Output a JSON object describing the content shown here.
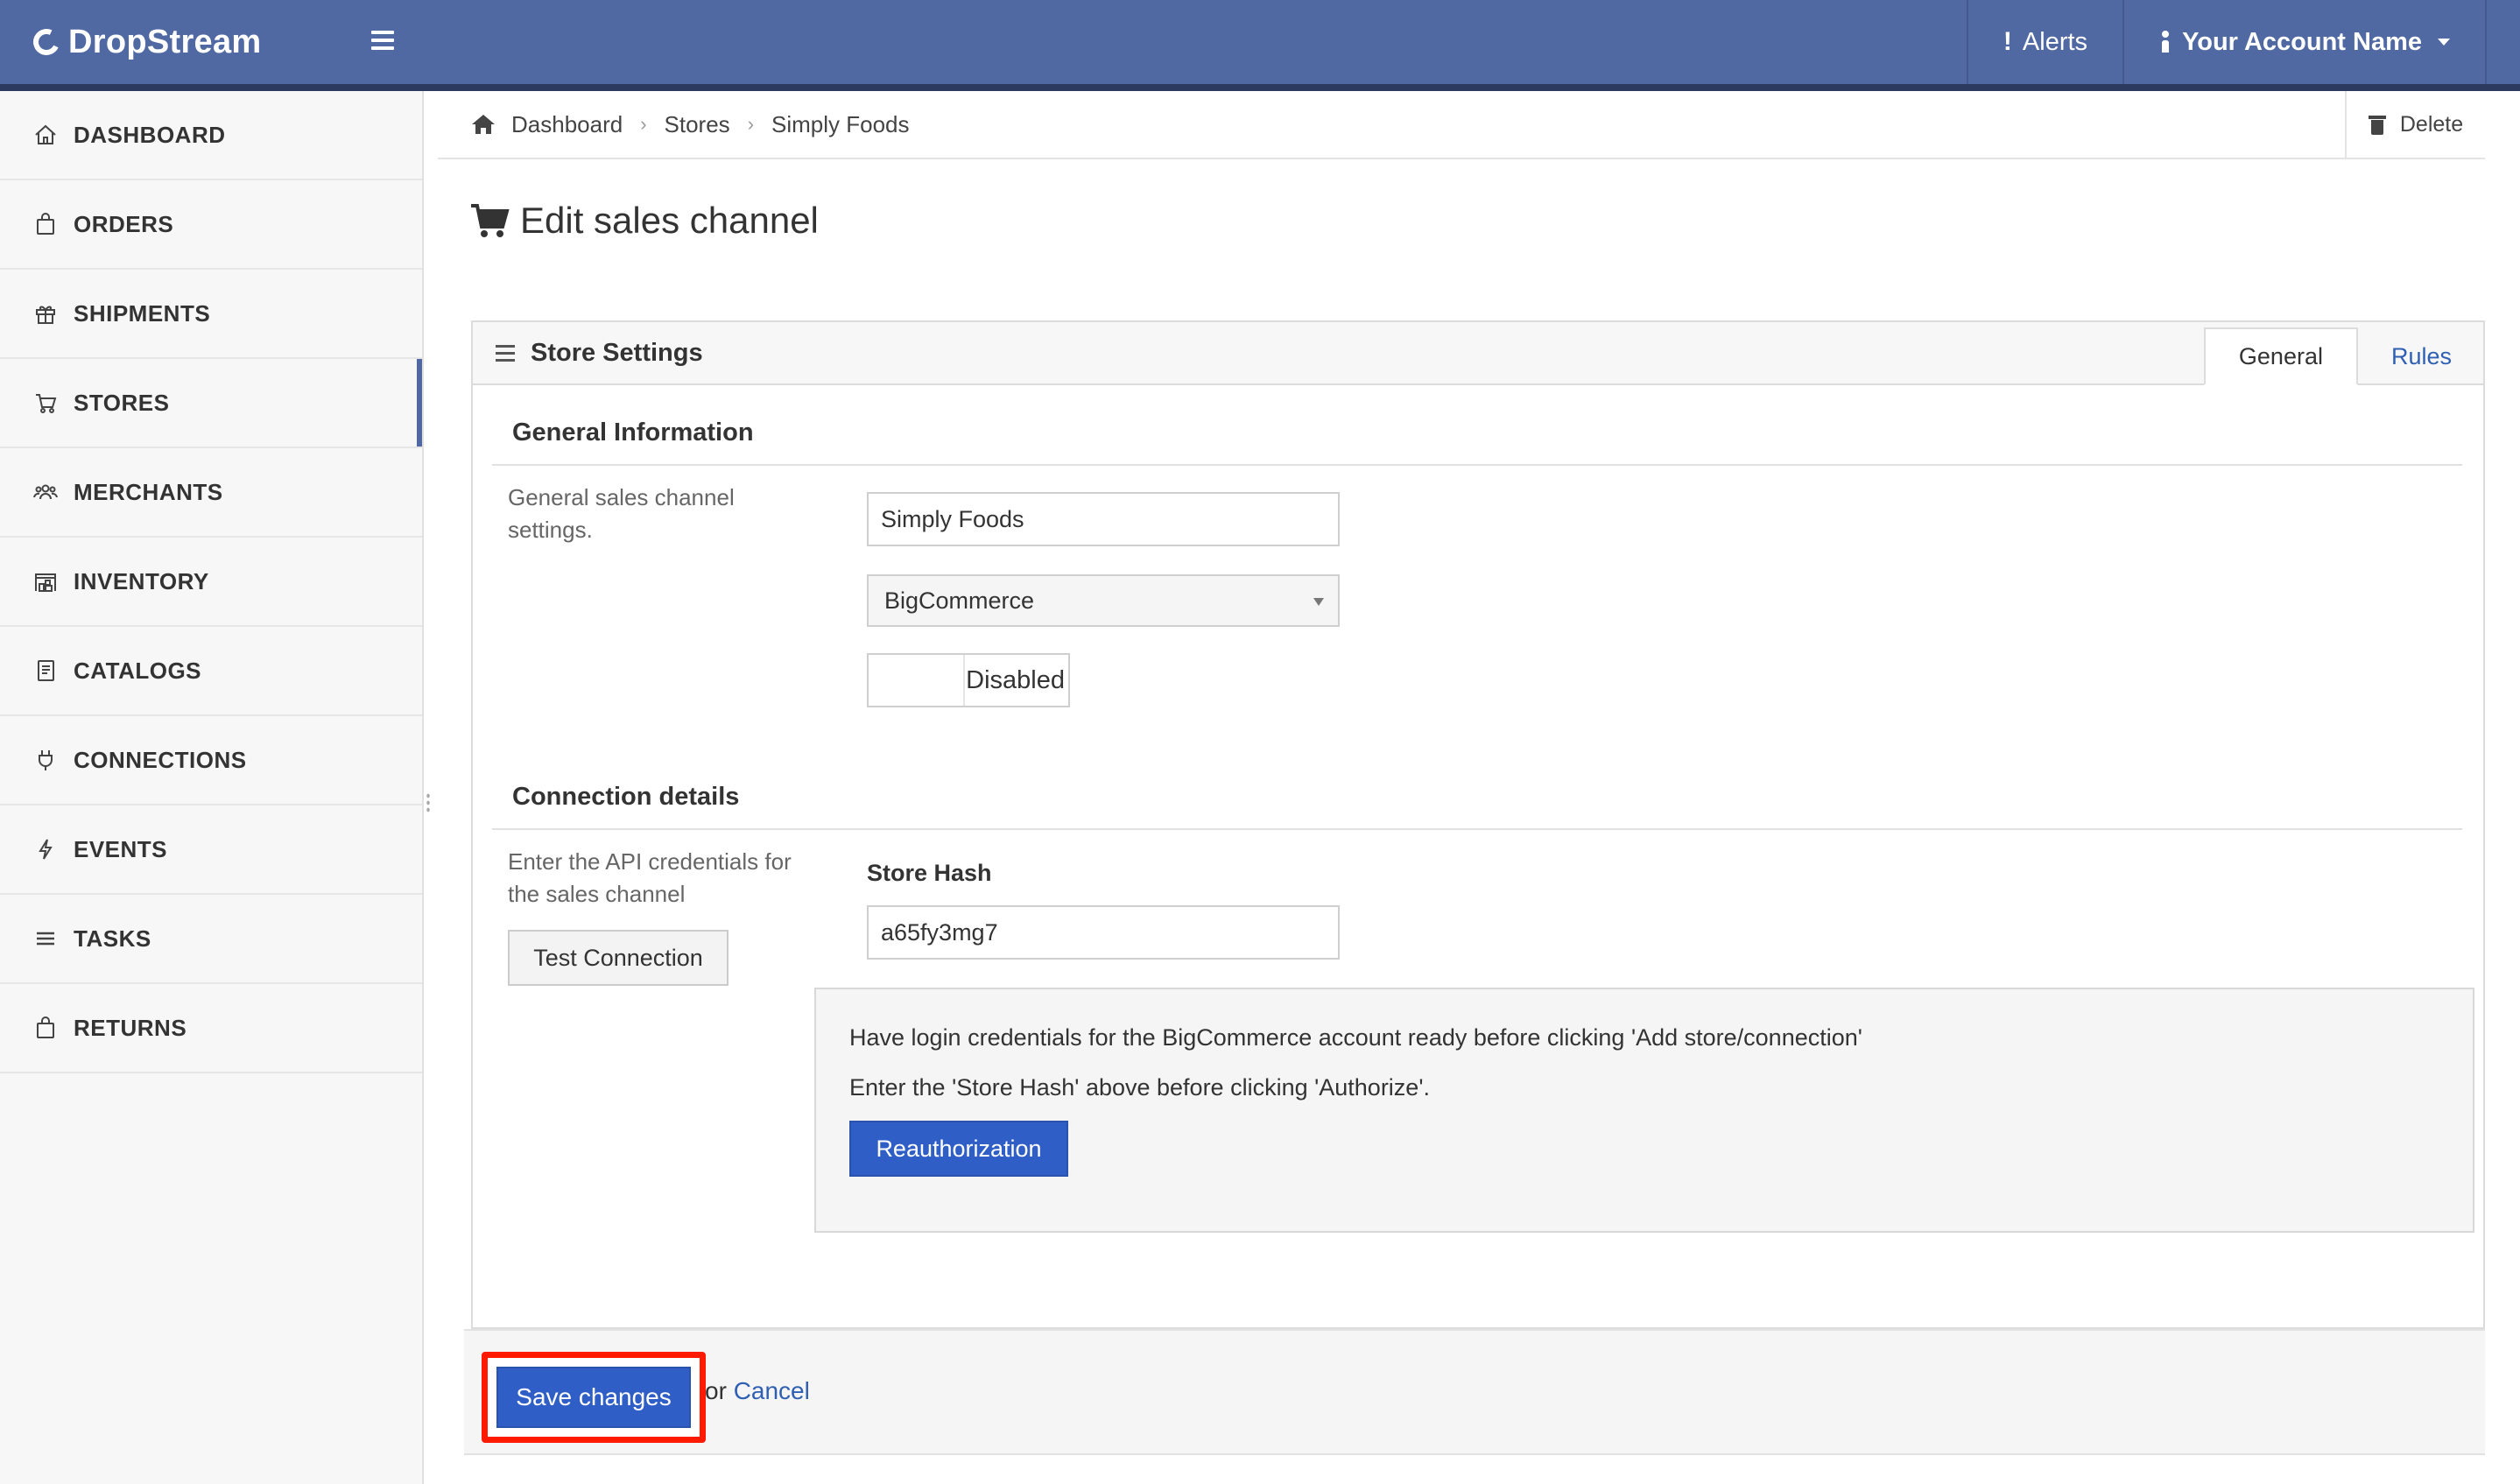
{
  "app": {
    "brand": "DropStream",
    "alerts_label": "Alerts",
    "alerts_mark": "!",
    "account_label": "Your Account Name"
  },
  "sidebar": {
    "items": [
      {
        "label": "DASHBOARD",
        "icon": "home-icon"
      },
      {
        "label": "ORDERS",
        "icon": "shopping-bag-icon"
      },
      {
        "label": "SHIPMENTS",
        "icon": "gift-box-icon"
      },
      {
        "label": "STORES",
        "icon": "cart-icon",
        "active": true
      },
      {
        "label": "MERCHANTS",
        "icon": "users-icon"
      },
      {
        "label": "INVENTORY",
        "icon": "warehouse-icon"
      },
      {
        "label": "CATALOGS",
        "icon": "book-icon"
      },
      {
        "label": "CONNECTIONS",
        "icon": "plug-icon"
      },
      {
        "label": "EVENTS",
        "icon": "bolt-icon"
      },
      {
        "label": "TASKS",
        "icon": "list-icon"
      },
      {
        "label": "RETURNS",
        "icon": "return-bag-icon"
      }
    ]
  },
  "breadcrumb": {
    "items": [
      "Dashboard",
      "Stores",
      "Simply Foods"
    ],
    "delete_label": "Delete"
  },
  "page": {
    "title": "Edit sales channel"
  },
  "panel": {
    "title": "Store Settings",
    "tabs": [
      {
        "label": "General",
        "active": true
      },
      {
        "label": "Rules",
        "active": false
      }
    ]
  },
  "general": {
    "title": "General Information",
    "help": "General sales channel settings.",
    "name_value": "Simply Foods",
    "platform_value": "BigCommerce",
    "status_value": "Disabled"
  },
  "connection": {
    "title": "Connection details",
    "help": "Enter the API credentials for the sales channel",
    "test_button": "Test Connection",
    "store_hash_label": "Store Hash",
    "store_hash_value": "a65fy3mg7",
    "info_line_1": "Have login credentials for the BigCommerce account ready before clicking 'Add store/connection'",
    "info_line_2": "Enter the 'Store Hash' above before clicking 'Authorize'.",
    "reauth_button": "Reauthorization"
  },
  "actions": {
    "save_label": "Save changes",
    "or_text": "or",
    "cancel_label": "Cancel"
  },
  "colors": {
    "topbar": "#5069a3",
    "primary_button": "#2f5fc6",
    "link": "#2f5fb3",
    "highlight_outline": "#ff1a00"
  }
}
